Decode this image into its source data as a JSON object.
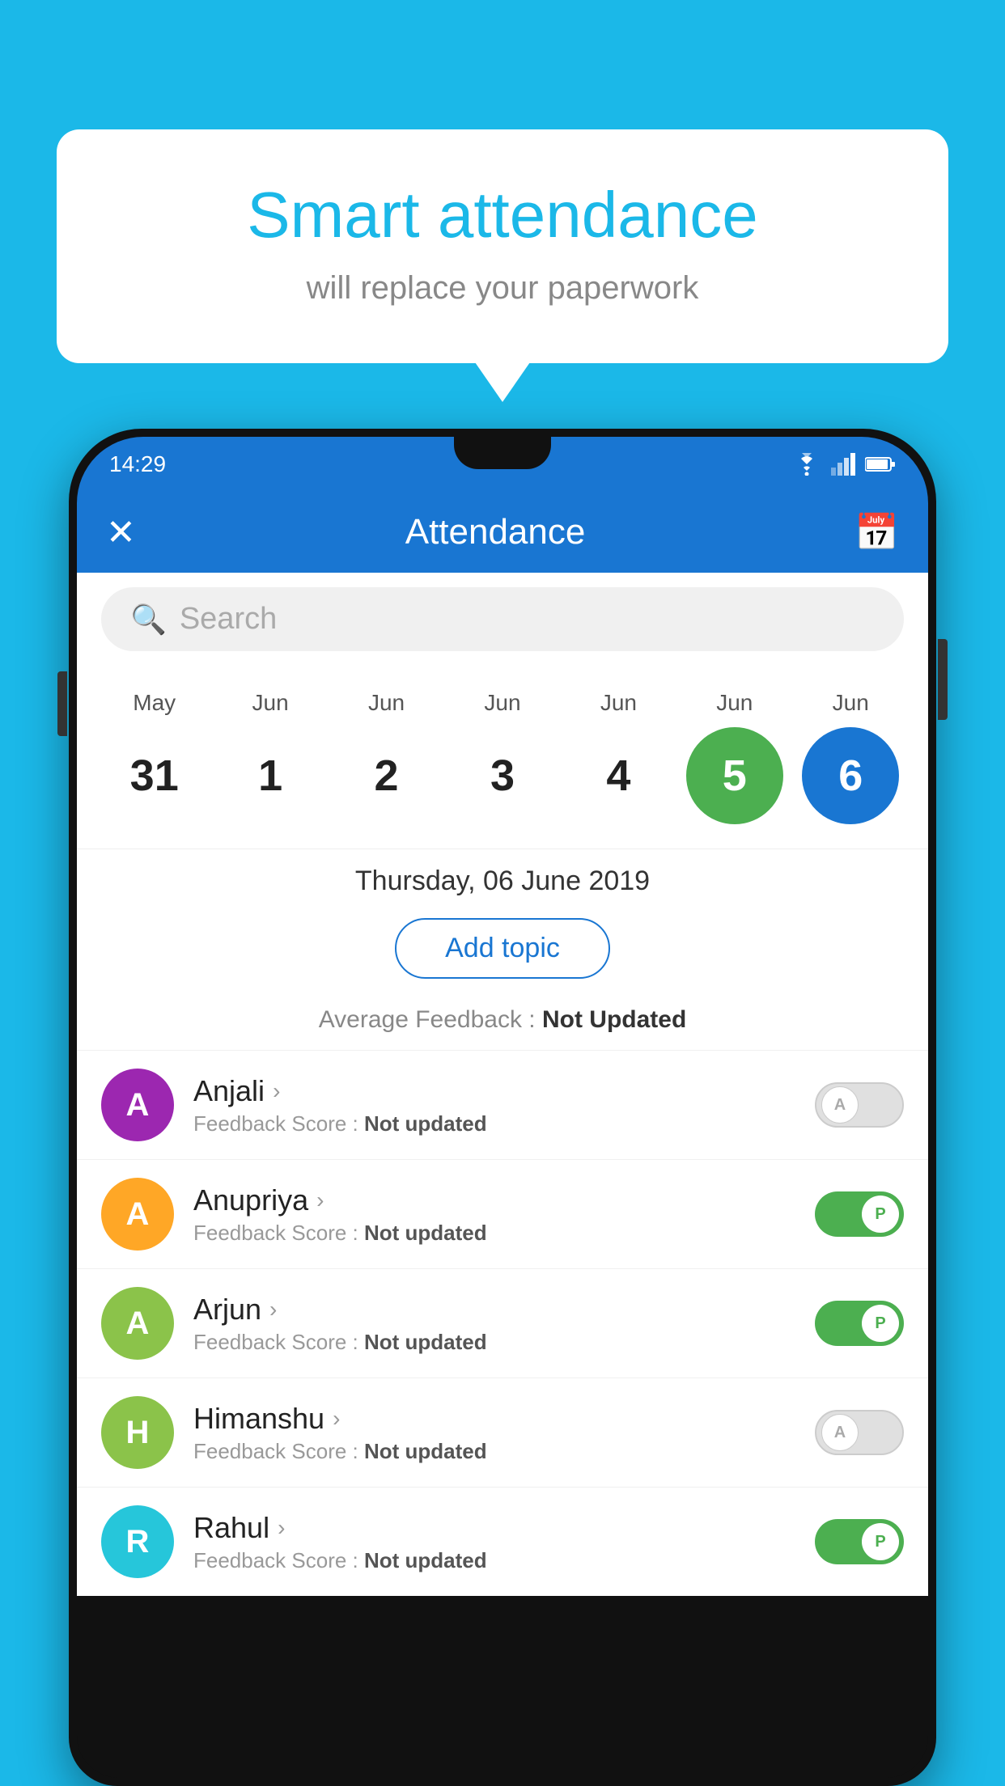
{
  "background_color": "#1bb8e8",
  "bubble": {
    "title": "Smart attendance",
    "subtitle": "will replace your paperwork"
  },
  "status_bar": {
    "time": "14:29",
    "color": "#1976d2"
  },
  "app_bar": {
    "title": "Attendance",
    "close_label": "✕",
    "calendar_label": "📅"
  },
  "search": {
    "placeholder": "Search"
  },
  "calendar": {
    "months": [
      "May",
      "Jun",
      "Jun",
      "Jun",
      "Jun",
      "Jun",
      "Jun"
    ],
    "days": [
      "31",
      "1",
      "2",
      "3",
      "4",
      "5",
      "6"
    ],
    "today_index": 5,
    "selected_index": 6
  },
  "date_header": "Thursday, 06 June 2019",
  "add_topic_label": "Add topic",
  "feedback_summary": {
    "label": "Average Feedback : ",
    "value": "Not Updated"
  },
  "students": [
    {
      "name": "Anjali",
      "initial": "A",
      "avatar_color": "#9c27b0",
      "feedback_label": "Feedback Score : ",
      "feedback_value": "Not updated",
      "status": "absent"
    },
    {
      "name": "Anupriya",
      "initial": "A",
      "avatar_color": "#ffa726",
      "feedback_label": "Feedback Score : ",
      "feedback_value": "Not updated",
      "status": "present"
    },
    {
      "name": "Arjun",
      "initial": "A",
      "avatar_color": "#8bc34a",
      "feedback_label": "Feedback Score : ",
      "feedback_value": "Not updated",
      "status": "present"
    },
    {
      "name": "Himanshu",
      "initial": "H",
      "avatar_color": "#8bc34a",
      "feedback_label": "Feedback Score : ",
      "feedback_value": "Not updated",
      "status": "absent"
    },
    {
      "name": "Rahul",
      "initial": "R",
      "avatar_color": "#26c6da",
      "feedback_label": "Feedback Score : ",
      "feedback_value": "Not updated",
      "status": "present"
    }
  ]
}
